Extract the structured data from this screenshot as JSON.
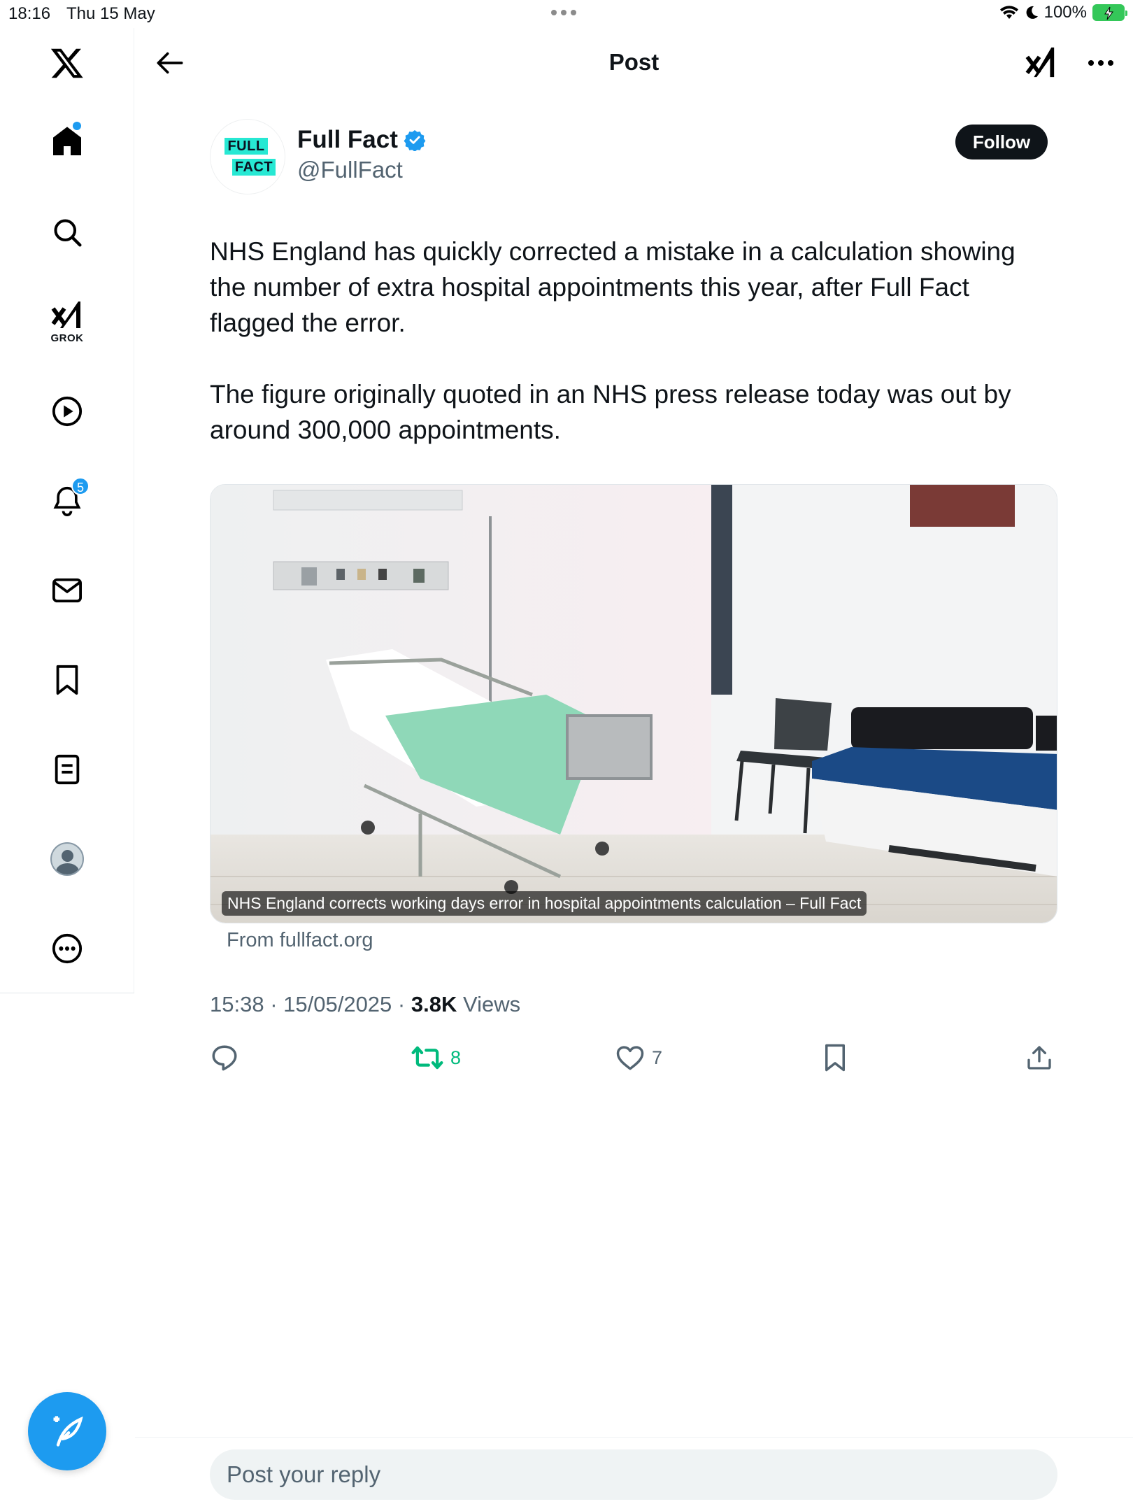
{
  "status_bar": {
    "time": "18:16",
    "date": "Thu 15 May",
    "battery": "100%",
    "icons": [
      "wifi-icon",
      "moon-icon",
      "battery-charging-icon"
    ]
  },
  "sidebar": {
    "items": [
      {
        "name": "x-logo",
        "icon": "x-logo-icon"
      },
      {
        "name": "home",
        "icon": "home-icon",
        "has_dot": true
      },
      {
        "name": "search",
        "icon": "search-icon"
      },
      {
        "name": "grok",
        "icon": "grok-icon",
        "label": "GROK"
      },
      {
        "name": "videos",
        "icon": "play-icon"
      },
      {
        "name": "notifications",
        "icon": "bell-icon",
        "badge": "5"
      },
      {
        "name": "messages",
        "icon": "mail-icon"
      },
      {
        "name": "bookmarks",
        "icon": "bookmark-icon"
      },
      {
        "name": "lists",
        "icon": "list-icon"
      },
      {
        "name": "profile",
        "icon": "avatar"
      },
      {
        "name": "more",
        "icon": "more-circle-icon"
      }
    ]
  },
  "header": {
    "title": "Post"
  },
  "post": {
    "author_name": "Full Fact",
    "author_handle": "@FullFact",
    "verified": true,
    "avatar_logo": {
      "line1": "FULL",
      "line2": "FACT"
    },
    "follow_label": "Follow",
    "text": "NHS England has quickly corrected a mistake in a calculation showing the number of extra hospital appointments this year, after Full Fact flagged the error.\n\nThe figure originally quoted in an NHS press release today was out by around 300,000 appointments.",
    "card": {
      "caption": "NHS England corrects working days error in hospital appointments calculation – Full Fact",
      "source": "From fullfact.org"
    },
    "time": "15:38",
    "date": "15/05/2025",
    "views_count": "3.8K",
    "views_label": "Views",
    "stats": {
      "reposts": "8",
      "likes": "7"
    }
  },
  "reply": {
    "placeholder": "Post your reply"
  },
  "colors": {
    "accent": "#1d9bf0",
    "repost": "#00ba7c",
    "text": "#0f1419",
    "muted": "#536471"
  }
}
